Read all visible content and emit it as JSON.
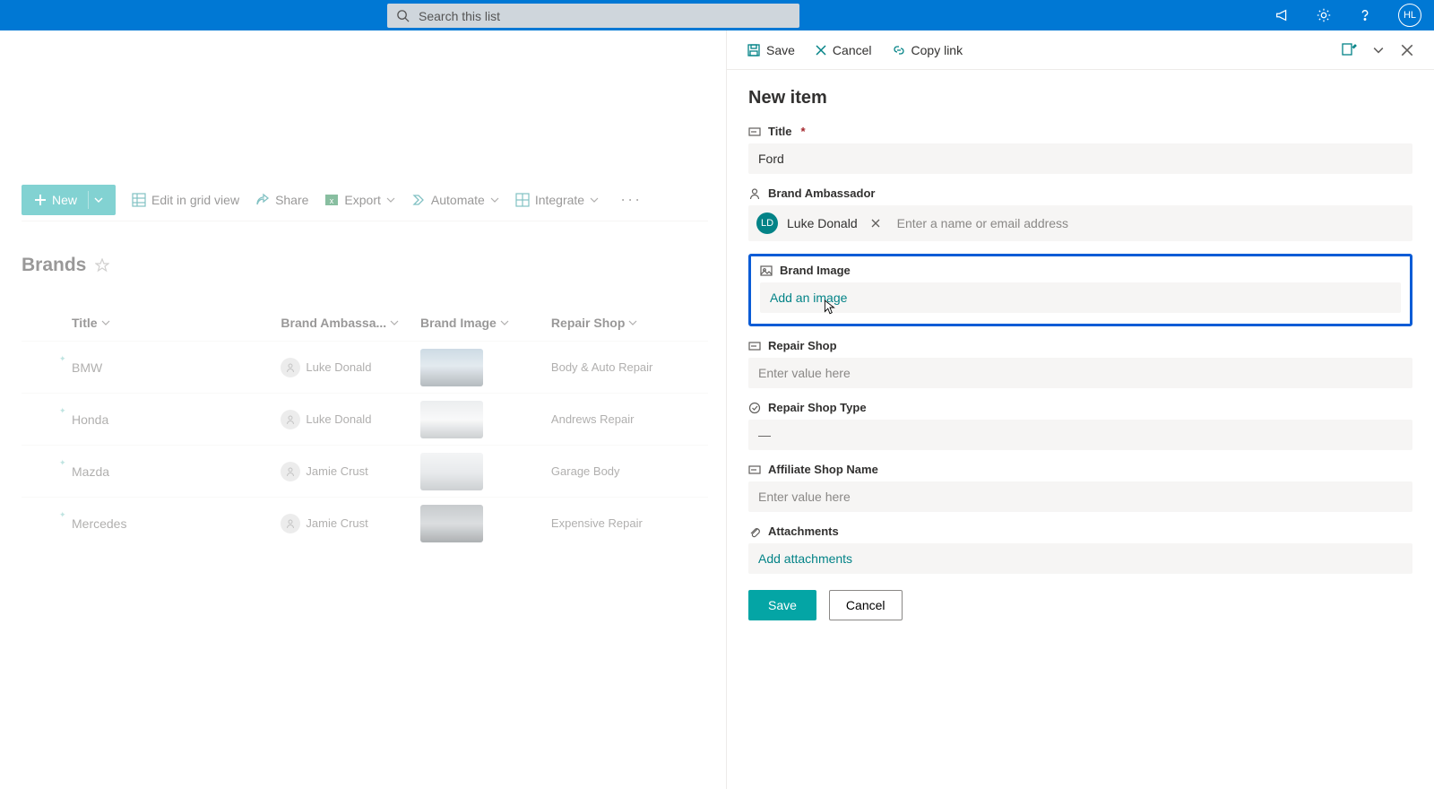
{
  "topbar": {
    "search_placeholder": "Search this list",
    "user_initials": "HL"
  },
  "cmdbar": {
    "new": "New",
    "edit_grid": "Edit in grid view",
    "share": "Share",
    "export": "Export",
    "automate": "Automate",
    "integrate": "Integrate"
  },
  "list": {
    "title": "Brands",
    "columns": {
      "title": "Title",
      "ambassador": "Brand Ambassa...",
      "image": "Brand Image",
      "repair": "Repair Shop"
    },
    "rows": [
      {
        "title": "BMW",
        "ambassador": "Luke Donald",
        "repair": "Body & Auto Repair",
        "car_bg": "linear-gradient(180deg,#9bb6c9 0%,#c6d5df 45%,#6a767d 100%)"
      },
      {
        "title": "Honda",
        "ambassador": "Luke Donald",
        "repair": "Andrews Repair",
        "car_bg": "linear-gradient(180deg,#d8dcdf 0%,#f1f2f3 50%,#9aa1a5 100%)"
      },
      {
        "title": "Mazda",
        "ambassador": "Jamie Crust",
        "repair": "Garage Body",
        "car_bg": "linear-gradient(180deg,#e8eaec 0%,#cfd4d8 55%,#9aa1a5 100%)"
      },
      {
        "title": "Mercedes",
        "ambassador": "Jamie Crust",
        "repair": "Expensive Repair",
        "car_bg": "linear-gradient(180deg,#8f969b 0%,#b7bcc0 50%,#5b6266 100%)"
      }
    ]
  },
  "panel": {
    "cmd_save": "Save",
    "cmd_cancel": "Cancel",
    "cmd_copy": "Copy link",
    "title": "New item",
    "fields": {
      "title_label": "Title",
      "title_value": "Ford",
      "amb_label": "Brand Ambassador",
      "amb_chip_initials": "LD",
      "amb_chip_name": "Luke Donald",
      "amb_placeholder": "Enter a name or email address",
      "img_label": "Brand Image",
      "img_placeholder": "Add an image",
      "repair_label": "Repair Shop",
      "repair_placeholder": "Enter value here",
      "repair_type_label": "Repair Shop Type",
      "repair_type_value": "—",
      "affiliate_label": "Affiliate Shop Name",
      "affiliate_placeholder": "Enter value here",
      "attach_label": "Attachments",
      "attach_link": "Add attachments"
    },
    "btn_save": "Save",
    "btn_cancel": "Cancel"
  }
}
